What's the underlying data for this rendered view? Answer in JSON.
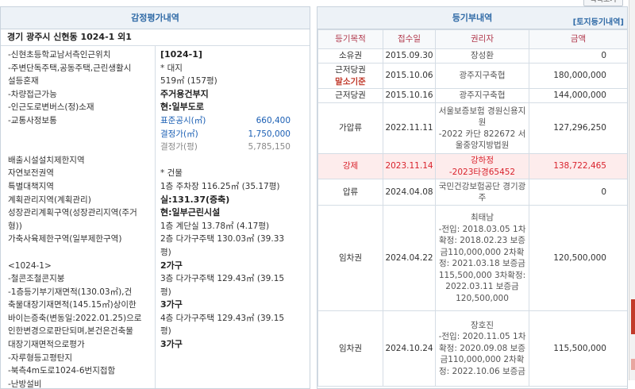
{
  "top_button": "목록보기",
  "appraisal": {
    "title": "감정평가내역",
    "address": "경기 광주시 신현동 1024-1 외1",
    "left_lines": [
      {
        "text": "-신현초등학교남서측인근위치"
      },
      {
        "text": "-주변단독주택,공동주택,근린생활시"
      },
      {
        "text": "설등혼재"
      },
      {
        "text": "-차량접근가능"
      },
      {
        "text": "-인근도로변버스(정)소재"
      },
      {
        "text": "-교통사정보통"
      },
      {
        "text": ""
      },
      {
        "text": ""
      },
      {
        "text": "배출시설설치제한지역"
      },
      {
        "text": "자연보전권역"
      },
      {
        "text": "특별대책지역"
      },
      {
        "text": "계획관리지역(계획관리)"
      },
      {
        "text": "성장관리계획구역(성장관리지역(주거"
      },
      {
        "text": "형))"
      },
      {
        "text": "가축사육제한구역(일부제한구역)"
      },
      {
        "text": ""
      },
      {
        "text": "<1024-1>"
      },
      {
        "text": "-철콘조철콘지붕"
      },
      {
        "text": "-1층등기부기재면적(130.03㎡),건"
      },
      {
        "text": "축물대장기재면적(145.15㎡)상이한"
      },
      {
        "text": "바이는증축(변동일:2022.01.25)으로"
      },
      {
        "text": "인한변경으로판단되며,본건은건축물"
      },
      {
        "text": "대장기재면적으로평가"
      },
      {
        "text": "-자루형등고평탄지"
      },
      {
        "text": "-북측4m도로1024-6번지접함"
      },
      {
        "text": "-난방설비"
      }
    ],
    "right_lines": [
      {
        "text": "[1024-1]",
        "style": "bold"
      },
      {
        "text": "* 대지",
        "style": "normal"
      },
      {
        "text": "519㎡ (157평)",
        "style": "normal"
      },
      {
        "text": "주거용건부지",
        "style": "bold"
      },
      {
        "text": "현:일부도로",
        "style": "bold"
      },
      {
        "text": "표준공시(㎡)",
        "value": "660,400",
        "style": "blue"
      },
      {
        "text": "결정가(㎡)",
        "value": "1,750,000",
        "style": "blue"
      },
      {
        "text": "결정가(평)",
        "value": "5,785,150",
        "style": "dim"
      },
      {
        "text": "",
        "style": "normal"
      },
      {
        "text": "* 건물",
        "style": "normal"
      },
      {
        "text": "1층 주차장 116.25㎡ (35.17평)",
        "style": "normal"
      },
      {
        "text": "실:131.37(증축)",
        "style": "bold"
      },
      {
        "text": "현:일부근린시설",
        "style": "bold"
      },
      {
        "text": "1층 계단실 13.78㎡ (4.17평)",
        "style": "normal"
      },
      {
        "text": "2층 다가구주택 130.03㎡ (39.33",
        "style": "normal"
      },
      {
        "text": "평)",
        "style": "normal"
      },
      {
        "text": "2가구",
        "style": "bold"
      },
      {
        "text": "3층 다가구주택 129.43㎡ (39.15",
        "style": "normal"
      },
      {
        "text": "평)",
        "style": "normal"
      },
      {
        "text": "3가구",
        "style": "bold"
      },
      {
        "text": "4층 다가구주택 129.43㎡ (39.15",
        "style": "normal"
      },
      {
        "text": "평)",
        "style": "normal"
      },
      {
        "text": "3가구",
        "style": "bold"
      }
    ]
  },
  "registry": {
    "title": "등기부내역",
    "land_link": "[토지등기내역]",
    "headers": [
      "등기목적",
      "접수일",
      "권리자",
      "금액"
    ],
    "rows": [
      {
        "type": "소유권",
        "type_note": "",
        "date": "2015.09.30",
        "holder": "장성환",
        "amount": "0",
        "red": false,
        "height": 18
      },
      {
        "type": "근저당권",
        "type_note": "말소기준",
        "date": "2015.10.06",
        "holder": "광주지구축협",
        "amount": "180,000,000",
        "red": false,
        "height": 32
      },
      {
        "type": "근저당권",
        "type_note": "",
        "date": "2015.10.16",
        "holder": "광주지구축협",
        "amount": "144,000,000",
        "red": false,
        "height": 18
      },
      {
        "type": "가압류",
        "type_note": "",
        "date": "2022.11.11",
        "holder": "서울보증보험 경원신용지원\n-2022 카단 822672 서울중앙지방법원",
        "amount": "127,296,250",
        "red": false,
        "height": 64
      },
      {
        "type": "강제",
        "type_note": "",
        "date": "2023.11.14",
        "holder": "강하정\n-2023타경65452",
        "amount": "138,722,465",
        "red": true,
        "height": 32
      },
      {
        "type": "압류",
        "type_note": "",
        "date": "2024.04.08",
        "holder": "국민건강보험공단 경기광주",
        "amount": "0",
        "red": false,
        "height": 33
      },
      {
        "type": "임차권",
        "type_note": "",
        "date": "2024.04.22",
        "holder": "최태남\n-전입: 2018.03.05 1차확정: 2018.02.23 보증금110,000,000 2차확정: 2021.03.18 보증금115,500,000 3차확정: 2022.03.11 보증금120,500,000",
        "amount": "120,500,000",
        "red": false,
        "height": 133
      },
      {
        "type": "임차권",
        "type_note": "",
        "date": "2024.10.24",
        "holder": "장호진\n-전입: 2020.11.05 1차확정: 2020.09.08 보증금110,000,000 2차확정: 2022.10.06 보증금",
        "amount": "115,500,000",
        "red": false,
        "height": 95
      }
    ]
  }
}
